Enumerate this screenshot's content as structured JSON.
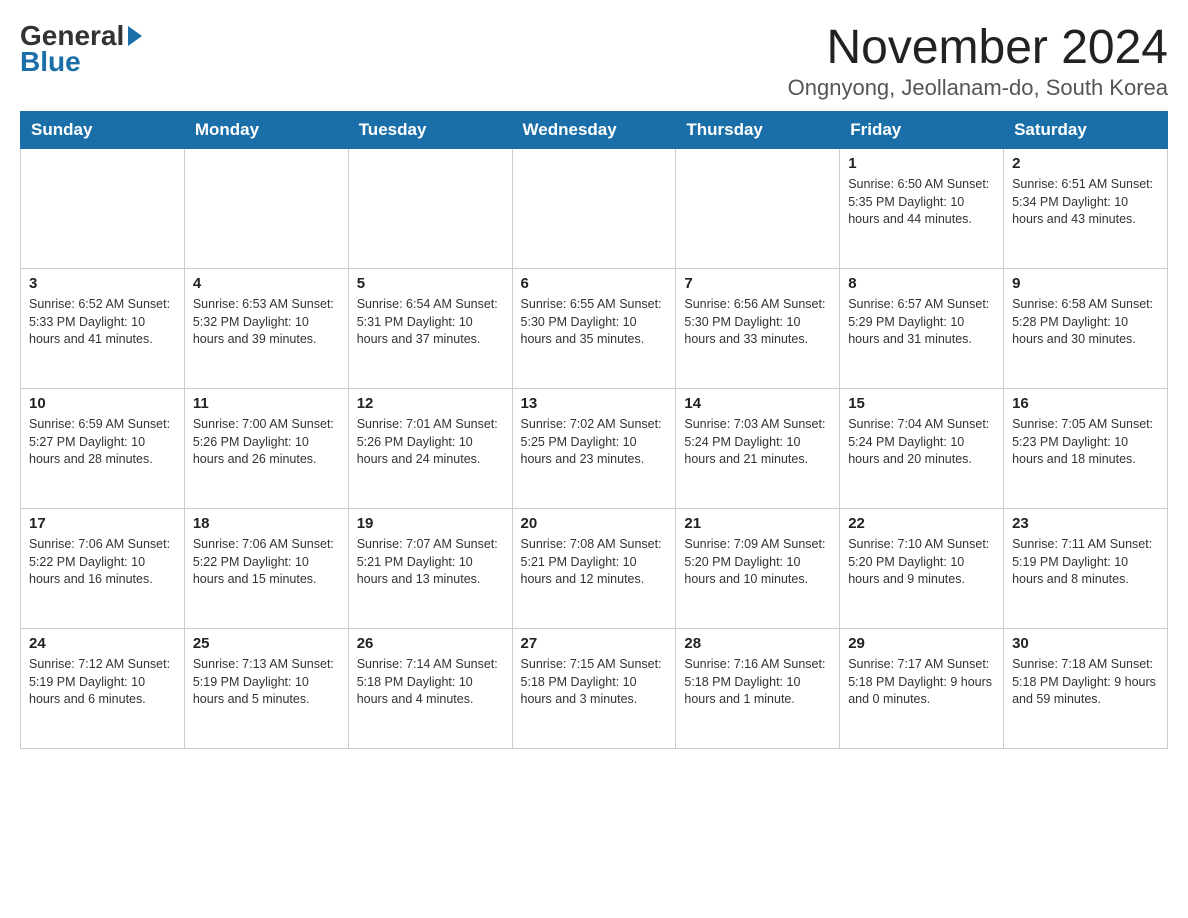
{
  "logo": {
    "general": "General",
    "blue": "Blue"
  },
  "title": "November 2024",
  "location": "Ongnyong, Jeollanam-do, South Korea",
  "days_of_week": [
    "Sunday",
    "Monday",
    "Tuesday",
    "Wednesday",
    "Thursday",
    "Friday",
    "Saturday"
  ],
  "weeks": [
    [
      {
        "day": "",
        "info": ""
      },
      {
        "day": "",
        "info": ""
      },
      {
        "day": "",
        "info": ""
      },
      {
        "day": "",
        "info": ""
      },
      {
        "day": "",
        "info": ""
      },
      {
        "day": "1",
        "info": "Sunrise: 6:50 AM\nSunset: 5:35 PM\nDaylight: 10 hours and 44 minutes."
      },
      {
        "day": "2",
        "info": "Sunrise: 6:51 AM\nSunset: 5:34 PM\nDaylight: 10 hours and 43 minutes."
      }
    ],
    [
      {
        "day": "3",
        "info": "Sunrise: 6:52 AM\nSunset: 5:33 PM\nDaylight: 10 hours and 41 minutes."
      },
      {
        "day": "4",
        "info": "Sunrise: 6:53 AM\nSunset: 5:32 PM\nDaylight: 10 hours and 39 minutes."
      },
      {
        "day": "5",
        "info": "Sunrise: 6:54 AM\nSunset: 5:31 PM\nDaylight: 10 hours and 37 minutes."
      },
      {
        "day": "6",
        "info": "Sunrise: 6:55 AM\nSunset: 5:30 PM\nDaylight: 10 hours and 35 minutes."
      },
      {
        "day": "7",
        "info": "Sunrise: 6:56 AM\nSunset: 5:30 PM\nDaylight: 10 hours and 33 minutes."
      },
      {
        "day": "8",
        "info": "Sunrise: 6:57 AM\nSunset: 5:29 PM\nDaylight: 10 hours and 31 minutes."
      },
      {
        "day": "9",
        "info": "Sunrise: 6:58 AM\nSunset: 5:28 PM\nDaylight: 10 hours and 30 minutes."
      }
    ],
    [
      {
        "day": "10",
        "info": "Sunrise: 6:59 AM\nSunset: 5:27 PM\nDaylight: 10 hours and 28 minutes."
      },
      {
        "day": "11",
        "info": "Sunrise: 7:00 AM\nSunset: 5:26 PM\nDaylight: 10 hours and 26 minutes."
      },
      {
        "day": "12",
        "info": "Sunrise: 7:01 AM\nSunset: 5:26 PM\nDaylight: 10 hours and 24 minutes."
      },
      {
        "day": "13",
        "info": "Sunrise: 7:02 AM\nSunset: 5:25 PM\nDaylight: 10 hours and 23 minutes."
      },
      {
        "day": "14",
        "info": "Sunrise: 7:03 AM\nSunset: 5:24 PM\nDaylight: 10 hours and 21 minutes."
      },
      {
        "day": "15",
        "info": "Sunrise: 7:04 AM\nSunset: 5:24 PM\nDaylight: 10 hours and 20 minutes."
      },
      {
        "day": "16",
        "info": "Sunrise: 7:05 AM\nSunset: 5:23 PM\nDaylight: 10 hours and 18 minutes."
      }
    ],
    [
      {
        "day": "17",
        "info": "Sunrise: 7:06 AM\nSunset: 5:22 PM\nDaylight: 10 hours and 16 minutes."
      },
      {
        "day": "18",
        "info": "Sunrise: 7:06 AM\nSunset: 5:22 PM\nDaylight: 10 hours and 15 minutes."
      },
      {
        "day": "19",
        "info": "Sunrise: 7:07 AM\nSunset: 5:21 PM\nDaylight: 10 hours and 13 minutes."
      },
      {
        "day": "20",
        "info": "Sunrise: 7:08 AM\nSunset: 5:21 PM\nDaylight: 10 hours and 12 minutes."
      },
      {
        "day": "21",
        "info": "Sunrise: 7:09 AM\nSunset: 5:20 PM\nDaylight: 10 hours and 10 minutes."
      },
      {
        "day": "22",
        "info": "Sunrise: 7:10 AM\nSunset: 5:20 PM\nDaylight: 10 hours and 9 minutes."
      },
      {
        "day": "23",
        "info": "Sunrise: 7:11 AM\nSunset: 5:19 PM\nDaylight: 10 hours and 8 minutes."
      }
    ],
    [
      {
        "day": "24",
        "info": "Sunrise: 7:12 AM\nSunset: 5:19 PM\nDaylight: 10 hours and 6 minutes."
      },
      {
        "day": "25",
        "info": "Sunrise: 7:13 AM\nSunset: 5:19 PM\nDaylight: 10 hours and 5 minutes."
      },
      {
        "day": "26",
        "info": "Sunrise: 7:14 AM\nSunset: 5:18 PM\nDaylight: 10 hours and 4 minutes."
      },
      {
        "day": "27",
        "info": "Sunrise: 7:15 AM\nSunset: 5:18 PM\nDaylight: 10 hours and 3 minutes."
      },
      {
        "day": "28",
        "info": "Sunrise: 7:16 AM\nSunset: 5:18 PM\nDaylight: 10 hours and 1 minute."
      },
      {
        "day": "29",
        "info": "Sunrise: 7:17 AM\nSunset: 5:18 PM\nDaylight: 9 hours and 0 minutes."
      },
      {
        "day": "30",
        "info": "Sunrise: 7:18 AM\nSunset: 5:18 PM\nDaylight: 9 hours and 59 minutes."
      }
    ]
  ]
}
